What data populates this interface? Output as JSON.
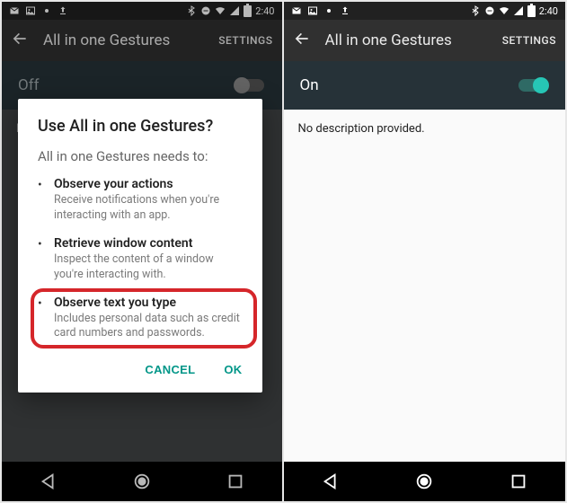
{
  "status": {
    "time": "2:40"
  },
  "app": {
    "title": "All in one Gestures",
    "settings_label": "SETTINGS"
  },
  "left": {
    "toggle_state": "Off",
    "dim_text": "N"
  },
  "right": {
    "toggle_state": "On",
    "body": "No description provided."
  },
  "dialog": {
    "title": "Use All in one Gestures?",
    "subtitle": "All in one Gestures needs to:",
    "perms": [
      {
        "title": "Observe your actions",
        "desc": "Receive notifications when you're interacting with an app."
      },
      {
        "title": "Retrieve window content",
        "desc": "Inspect the content of a window you're interacting with."
      },
      {
        "title": "Observe text you type",
        "desc": "Includes personal data such as credit card numbers and passwords."
      }
    ],
    "cancel": "CANCEL",
    "ok": "OK"
  }
}
